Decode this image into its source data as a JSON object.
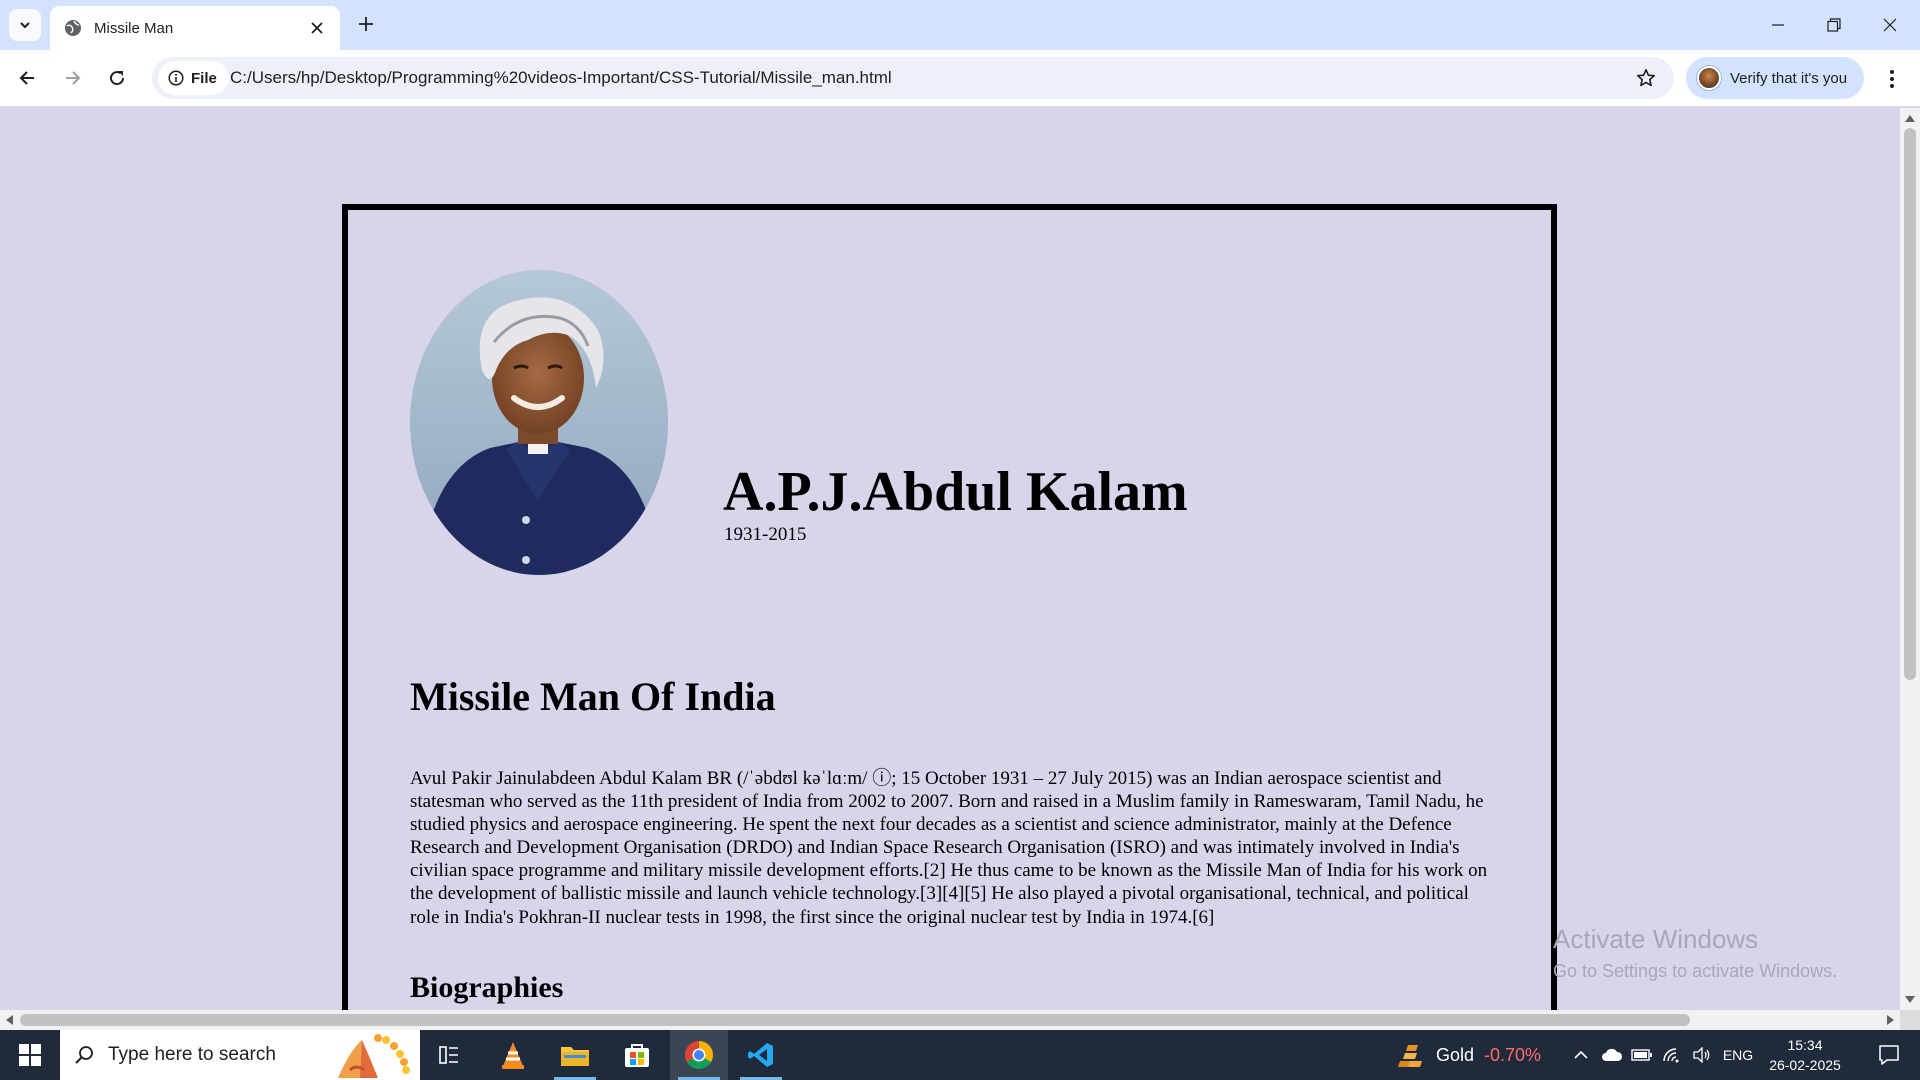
{
  "browser": {
    "tab": {
      "title": "Missile Man"
    },
    "address_bar": {
      "scheme_chip": "File",
      "url": "C:/Users/hp/Desktop/Programming%20videos-Important/CSS-Tutorial/Missile_man.html"
    },
    "profile_button": {
      "label": "Verify that it's you"
    }
  },
  "page": {
    "name": "A.P.J.Abdul Kalam",
    "years": "1931-2015",
    "heading": "Missile Man Of India",
    "bio": "Avul Pakir Jainulabdeen Abdul Kalam BR (/ˈəbdʊl kəˈlɑːm/ ⓘ; 15 October 1931 – 27 July 2015) was an Indian aerospace scientist and statesman who served as the 11th president of India from 2002 to 2007. Born and raised in a Muslim family in Rameswaram, Tamil Nadu, he studied physics and aerospace engineering. He spent the next four decades as a scientist and science administrator, mainly at the Defence Research and Development Organisation (DRDO) and Indian Space Research Organisation (ISRO) and was intimately involved in India's civilian space programme and military missile development efforts.[2] He thus came to be known as the Missile Man of India for his work on the development of ballistic missile and launch vehicle technology.[3][4][5] He also played a pivotal organisational, technical, and political role in India's Pokhran-II nuclear tests in 1998, the first since the original nuclear test by India in 1974.[6]",
    "subheading": "Biographies",
    "background_color": "#d8d4ea",
    "border_color": "#000000"
  },
  "watermark": {
    "line1": "Activate Windows",
    "line2": "Go to Settings to activate Windows."
  },
  "taskbar": {
    "search_placeholder": "Type here to search",
    "pinned": [
      "task-view",
      "vlc",
      "file-explorer",
      "microsoft-store",
      "chrome",
      "vscode"
    ],
    "active_app": "chrome",
    "widget": {
      "label": "Gold",
      "value": "-0.70%",
      "value_color": "#ff6a6a"
    },
    "language": "ENG",
    "time": "15:34",
    "date": "26-02-2025"
  }
}
